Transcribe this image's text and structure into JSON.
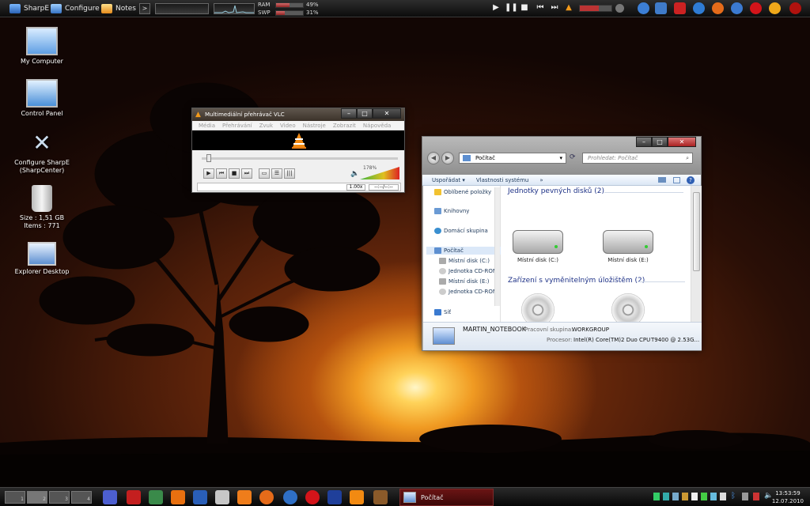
{
  "topbar": {
    "sharpe_label": "SharpE",
    "configure_label": "Configure",
    "notes_label": "Notes",
    "ram_label": "RAM",
    "ram_value": "49%",
    "ram_fraction": 0.49,
    "swp_label": "SWP",
    "swp_value": "31%",
    "swp_fraction": 0.31
  },
  "desktop_icons": [
    {
      "label": "My Computer"
    },
    {
      "label": "Control Panel"
    },
    {
      "label": "Configure SharpE (SharpCenter)"
    },
    {
      "label": "Size : 1,51 GB"
    },
    {
      "label": "Items : 771"
    },
    {
      "label": "Explorer Desktop"
    }
  ],
  "vlc": {
    "title": "Multimediální přehrávač VLC",
    "menu": [
      "Média",
      "Přehrávání",
      "Zvuk",
      "Video",
      "Nástroje",
      "Zobrazit",
      "Nápověda"
    ],
    "volume_label": "178%",
    "speed": "1.00x",
    "time": "--:--/--:--"
  },
  "explorer": {
    "address": "Počítač",
    "search_placeholder": "Prohledat: Počítač",
    "commands": [
      "Uspořádat ▾",
      "Vlastnosti systému",
      "»"
    ],
    "nav": [
      "Oblíbené položky",
      "Knihovny",
      "Domácí skupina",
      "Počítač",
      "Místní disk (C:)",
      "Jednotka CD-ROM",
      "Místní disk (E:)",
      "Jednotka CD-ROM",
      "Síť"
    ],
    "group1": "Jednotky pevných disků (2)",
    "drives": [
      "Místní disk (C:)",
      "Místní disk (E:)"
    ],
    "group2": "Zařízení s vyměnitelným úložištěm (2)",
    "details": {
      "computer_name": "MARTIN_NOTEBOOK",
      "workgroup_label": "Pracovní skupina:",
      "workgroup": "WORKGROUP",
      "cpu_label": "Procesor:",
      "cpu": "Intel(R) Core(TM)2 Duo CPU",
      "cpu_model": "T9400  @ 2.53G..."
    }
  },
  "taskbar": {
    "pagers": [
      "1",
      "2",
      "3",
      "4"
    ],
    "task_label": "Počítač",
    "time": "13:53:59",
    "date": "12.07.2010"
  },
  "colors": {
    "accent_red": "#8e2424",
    "explorer_link": "#1e3287"
  }
}
